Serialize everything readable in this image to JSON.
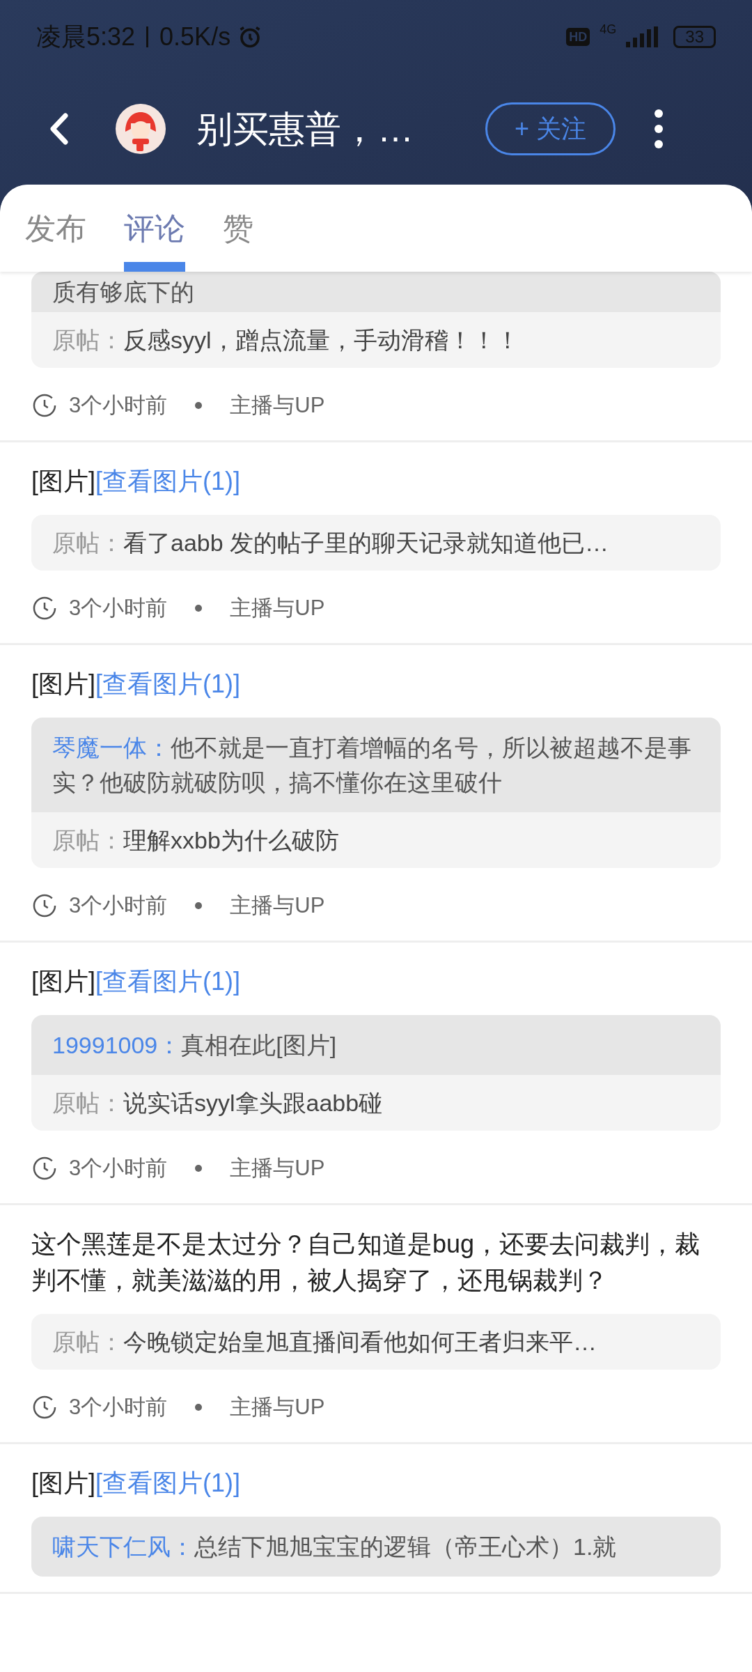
{
  "status_bar": {
    "time": "凌晨5:32",
    "speed": "0.5K/s",
    "hd": "HD",
    "network": "4G",
    "battery": "33"
  },
  "header": {
    "title": "别买惠普，…",
    "follow": "+ 关注"
  },
  "tabs": [
    {
      "label": "发布",
      "selected": false
    },
    {
      "label": "评论",
      "selected": true
    },
    {
      "label": "赞",
      "selected": false
    }
  ],
  "items": [
    {
      "reply": {
        "text": "质有够底下的"
      },
      "original_label": "原帖：",
      "original": "反感syyl，蹭点流量，手动滑稽！！！",
      "time": "3个小时前",
      "category": "主播与UP"
    },
    {
      "text": "[图片]",
      "link": "[查看图片(1)]",
      "original_label": "原帖：",
      "original": "看了aabb 发的帖子里的聊天记录就知道他已…",
      "time": "3个小时前",
      "category": "主播与UP"
    },
    {
      "text": "[图片]",
      "link": "[查看图片(1)]",
      "reply": {
        "author": "琴魔一体：",
        "text": "他不就是一直打着增幅的名号，所以被超越不是事实？他破防就破防呗，搞不懂你在这里破什"
      },
      "original_label": "原帖：",
      "original": "理解xxbb为什么破防",
      "time": "3个小时前",
      "category": "主播与UP"
    },
    {
      "text": "[图片]",
      "link": "[查看图片(1)]",
      "reply": {
        "author": "19991009：",
        "text": "真相在此[图片]"
      },
      "original_label": "原帖：",
      "original": "说实话syyl拿头跟aabb碰",
      "time": "3个小时前",
      "category": "主播与UP"
    },
    {
      "text": "这个黑莲是不是太过分？自己知道是bug，还要去问裁判，裁判不懂，就美滋滋的用，被人揭穿了，还甩锅裁判？",
      "original_label": "原帖：",
      "original": "今晚锁定始皇旭直播间看他如何王者归来平…",
      "time": "3个小时前",
      "category": "主播与UP"
    },
    {
      "text": "[图片]",
      "link": "[查看图片(1)]",
      "reply": {
        "author": "啸天下仁风：",
        "text": "总结下旭旭宝宝的逻辑（帝王心术）1.就"
      }
    }
  ]
}
